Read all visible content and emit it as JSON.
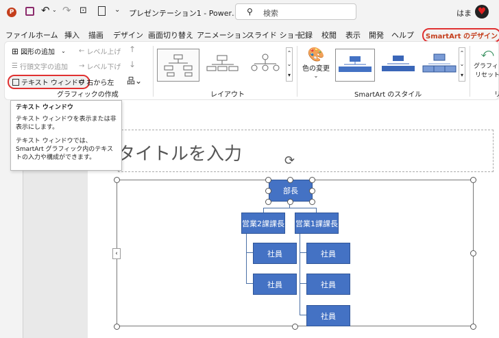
{
  "titlebar": {
    "doc_title": "プレゼンテーション1 - Power…",
    "search_placeholder": "検索",
    "user_name": "はま"
  },
  "menu": {
    "tabs": [
      "ファイル",
      "ホーム",
      "挿入",
      "描画",
      "デザイン",
      "画面切り替え",
      "アニメーション",
      "スライド ショー",
      "記録",
      "校閲",
      "表示",
      "開発",
      "ヘルプ",
      "SmartArt のデザイン"
    ]
  },
  "ribbon": {
    "add_shape": "図形の追加",
    "promote": "レベル上げ",
    "add_bullet": "行頭文字の追加",
    "demote": "レベル下げ",
    "text_pane": "テキスト ウィンドウ",
    "right_to_left": "右から左",
    "group_create": "グラフィックの作成",
    "group_layout": "レイアウト",
    "change_colors": "色の変更",
    "group_styles": "SmartArt のスタイル",
    "reset": "グラフィックの",
    "reset2": "リセット",
    "group_reset": "リ"
  },
  "tooltip": {
    "title": "テキスト ウィンドウ",
    "p1": "テキスト ウィンドウを表示または非表示にします。",
    "p2": "テキスト ウィンドウでは、SmartArt グラフィック内のテキストの入力や構成ができます。"
  },
  "slide": {
    "title_placeholder": "タイトルを入力",
    "nodes": {
      "top": "部長",
      "left_mgr": "営業2課課長",
      "right_mgr": "営業1課課長",
      "emp": "社員"
    }
  },
  "colors": {
    "accent": "#c43e1c",
    "smartart": "#4472c4",
    "highlight": "#e03030"
  }
}
